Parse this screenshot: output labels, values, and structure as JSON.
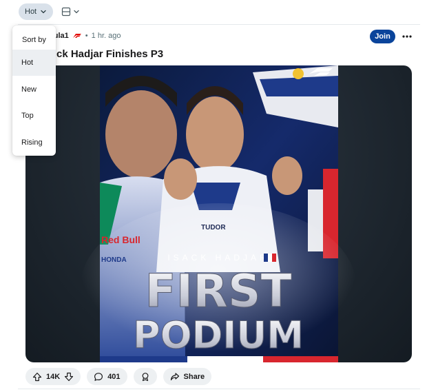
{
  "toolbar": {
    "sort_label": "Hot"
  },
  "sort_menu": {
    "header": "Sort by",
    "items": [
      "Hot",
      "New",
      "Top",
      "Rising"
    ],
    "selected": "Hot"
  },
  "post": {
    "community_partial": "mula1",
    "time": "1 hr. ago",
    "title_partial": "ck Hadjar Finishes P3",
    "join_label": "Join",
    "image_text": {
      "driver_name": "ISACK HADJAR",
      "headline_1": "FIRST",
      "headline_2": "PODIUM",
      "sponsor_1": "Red Bull",
      "sponsor_2": "HONDA",
      "sponsor_3": "TUDOR"
    }
  },
  "actions": {
    "votes": "14K",
    "comments": "401",
    "share_label": "Share"
  },
  "colors": {
    "accent": "#0a449b",
    "pill_bg": "#edf0f2",
    "sort_pill_bg": "#d9e1ea",
    "f1_red": "#e10600"
  }
}
